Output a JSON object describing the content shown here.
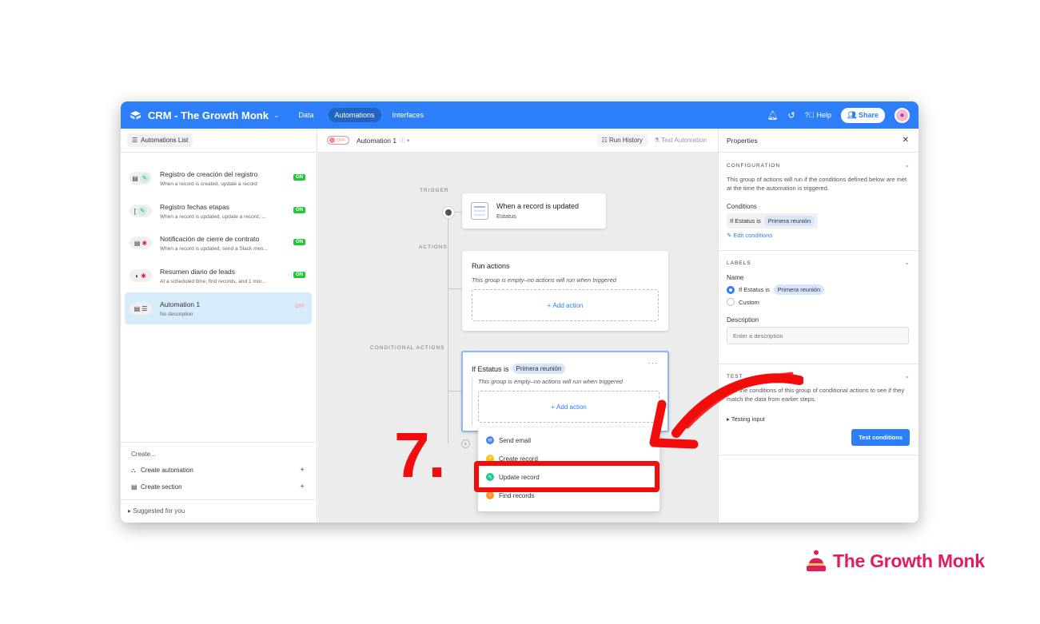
{
  "topbar": {
    "app_title": "CRM - The Growth Monk",
    "tabs": [
      "Data",
      "Automations",
      "Interfaces"
    ],
    "help_label": "Help",
    "share_label": "Share"
  },
  "left": {
    "list_button": "Automations List",
    "items": [
      {
        "title": "Registro de creación del registro",
        "sub": "When a record is created, update a record",
        "status": "ON"
      },
      {
        "title": "Registro fechas etapas",
        "sub": "When a record is updated, update a record, ...",
        "status": "ON"
      },
      {
        "title": "Notificación de cierre de contrato",
        "sub": "When a record is updated, send a Slack mes...",
        "status": "ON"
      },
      {
        "title": "Resumen diario de leads",
        "sub": "At a scheduled time, find records, and 1 mor...",
        "status": "ON"
      },
      {
        "title": "Automation 1",
        "sub": "No description",
        "status": "OFF"
      }
    ],
    "create_label": "Create...",
    "create_automation": "Create automation",
    "create_section": "Create section",
    "suggested": "Suggested for you"
  },
  "canvas": {
    "toggle_label": "OFF",
    "automation_name": "Automation 1",
    "run_history": "Run History",
    "test_automation": "Test Automation",
    "label_trigger": "TRIGGER",
    "label_actions": "ACTIONS",
    "label_conditional": "CONDITIONAL ACTIONS",
    "trigger_title": "When a record is updated",
    "trigger_sub": "Estatus",
    "run_actions_title": "Run actions",
    "empty_text": "This group is empty–no actions will run when triggered",
    "add_action": "Add action",
    "cond_prefix": "If Estatus is",
    "cond_value": "Primera reunión",
    "dropdown": [
      "Send email",
      "Create record",
      "Update record",
      "Find records"
    ]
  },
  "properties": {
    "title": "Properties",
    "config_head": "CONFIGURATION",
    "config_text": "This group of actions will run if the conditions defined below are met at the time the automation is triggered.",
    "conditions_label": "Conditions",
    "cond_prefix": "If Estatus is",
    "cond_value": "Primera reunión",
    "edit_conditions": "Edit conditions",
    "labels_head": "LABELS",
    "name_label": "Name",
    "radio_custom": "Custom",
    "description_label": "Description",
    "description_placeholder": "Enter a description",
    "test_head": "TEST",
    "test_text": "Test the conditions of this group of conditional actions to see if they match the data from earlier steps.",
    "testing_input": "Testing input",
    "test_button": "Test conditions"
  },
  "overlay": {
    "step_number": "7."
  },
  "brand": {
    "name": "The Growth Monk"
  },
  "colors": {
    "accent": "#2d7ff9",
    "annotation_red": "#f20d0d",
    "brand": "#e11d5c",
    "on_badge": "#20c933"
  }
}
